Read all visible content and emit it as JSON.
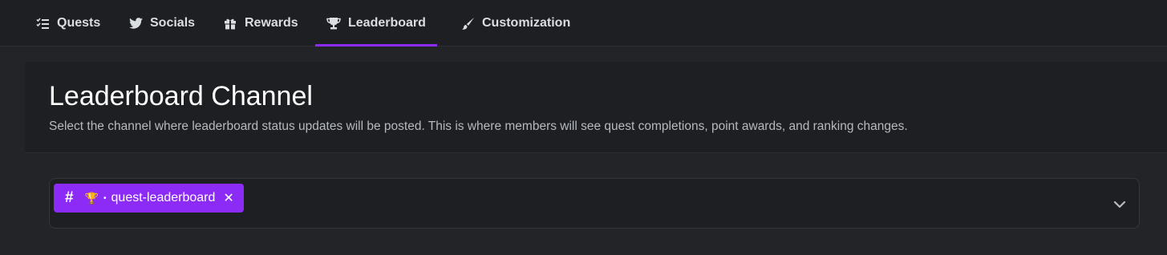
{
  "tabs": [
    {
      "label": "Quests",
      "icon": "checklist-icon"
    },
    {
      "label": "Socials",
      "icon": "twitter-icon"
    },
    {
      "label": "Rewards",
      "icon": "gift-icon"
    },
    {
      "label": "Leaderboard",
      "icon": "trophy-icon",
      "active": true
    },
    {
      "label": "Customization",
      "icon": "brush-icon"
    }
  ],
  "accent_color": "#8b2bf5",
  "section": {
    "title": "Leaderboard Channel",
    "description": "Select the channel where leaderboard status updates will be posted. This is where members will see quest completions, point awards, and ranking changes."
  },
  "channel_select": {
    "selected": {
      "prefix": "#",
      "emoji": "🏆",
      "separator": "•",
      "name": "quest-leaderboard",
      "remove_symbol": "✕"
    }
  }
}
